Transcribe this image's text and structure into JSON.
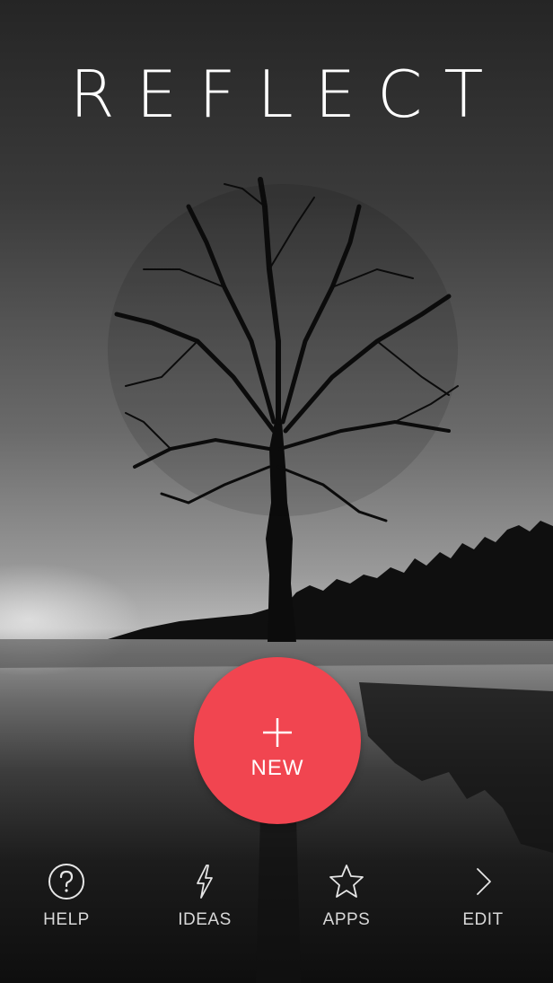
{
  "app": {
    "title": "REFLECT"
  },
  "new_button": {
    "label": "NEW",
    "color": "#f14550"
  },
  "tabs": [
    {
      "label": "HELP",
      "icon": "help-circle-icon"
    },
    {
      "label": "IDEAS",
      "icon": "lightning-bolt-icon"
    },
    {
      "label": "APPS",
      "icon": "star-icon"
    },
    {
      "label": "EDIT",
      "icon": "chevron-right-icon"
    }
  ]
}
